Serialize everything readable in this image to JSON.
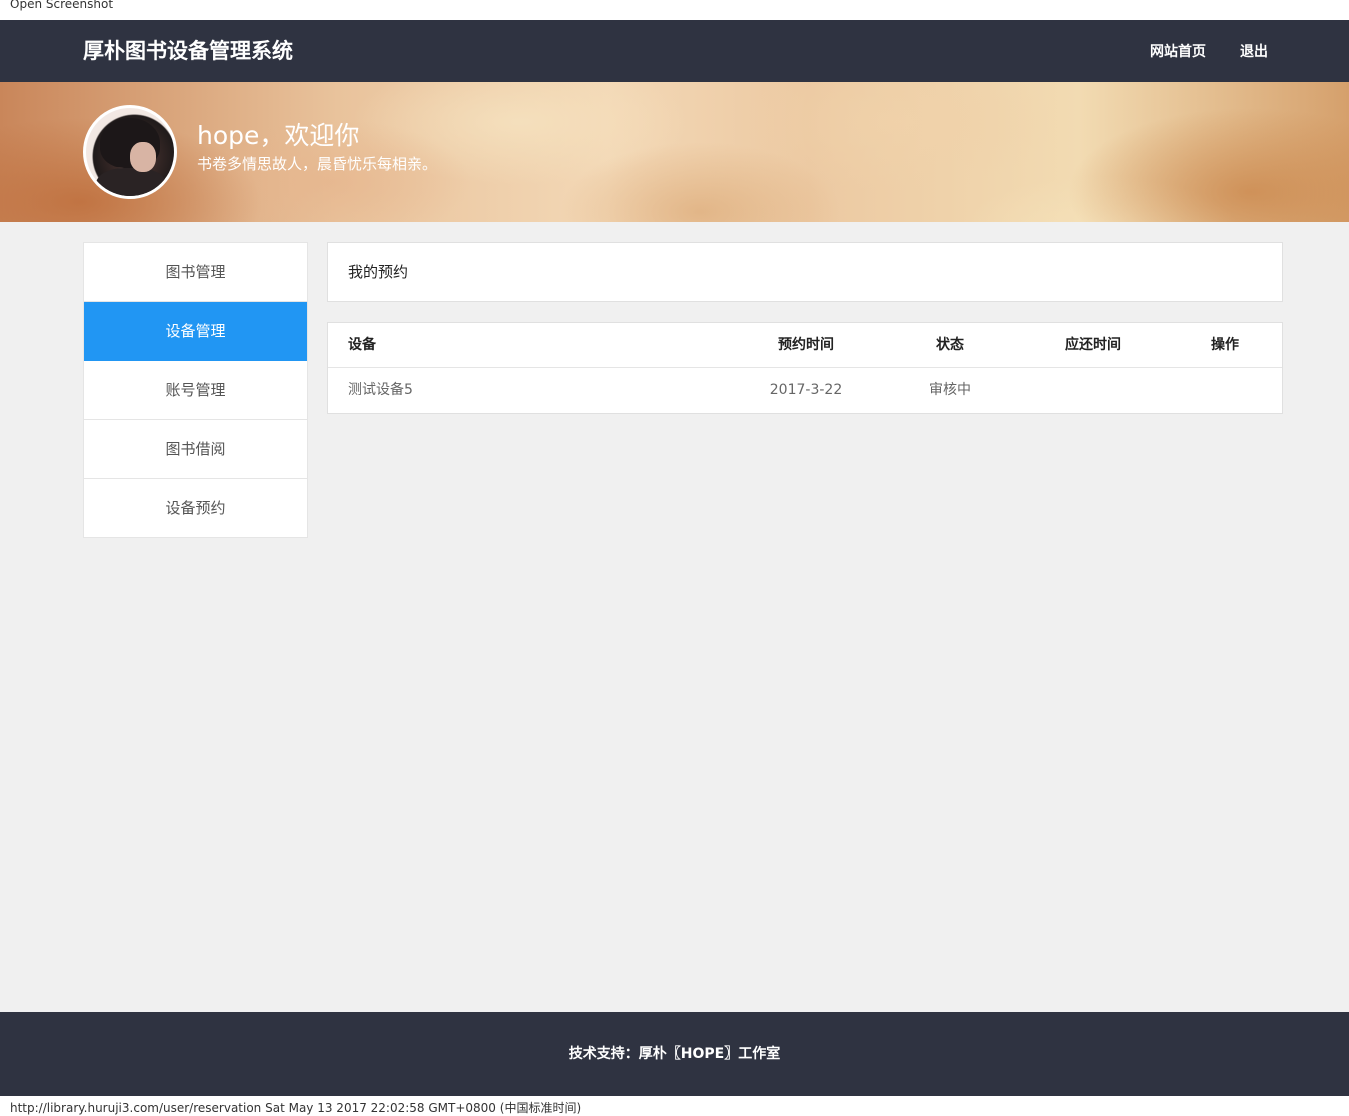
{
  "caption": "Open Screenshot",
  "header": {
    "title": "厚朴图书设备管理系统",
    "nav": [
      "网站首页",
      "退出"
    ]
  },
  "profile": {
    "welcome": "hope，欢迎你",
    "motto": "书卷多情思故人，晨昏忧乐每相亲。"
  },
  "sidebar": {
    "items": [
      {
        "label": "图书管理",
        "active": false
      },
      {
        "label": "设备管理",
        "active": true
      },
      {
        "label": "账号管理",
        "active": false
      },
      {
        "label": "图书借阅",
        "active": false
      },
      {
        "label": "设备预约",
        "active": false
      }
    ]
  },
  "main": {
    "title": "我的预约",
    "table": {
      "headers": [
        "设备",
        "预约时间",
        "状态",
        "应还时间",
        "操作"
      ],
      "rows": [
        [
          "测试设备5",
          "2017-3-22",
          "审核中",
          "",
          ""
        ]
      ]
    }
  },
  "footer": {
    "text": "技术支持：厚朴〖HOPE〗工作室"
  },
  "statusbar": {
    "text": "http://library.huruji3.com/user/reservation Sat May 13 2017 22:02:58 GMT+0800 (中国标准时间)"
  },
  "colors": {
    "header_bg": "#2f3341",
    "accent": "#2196f3",
    "content_bg": "#f0f0f0"
  }
}
